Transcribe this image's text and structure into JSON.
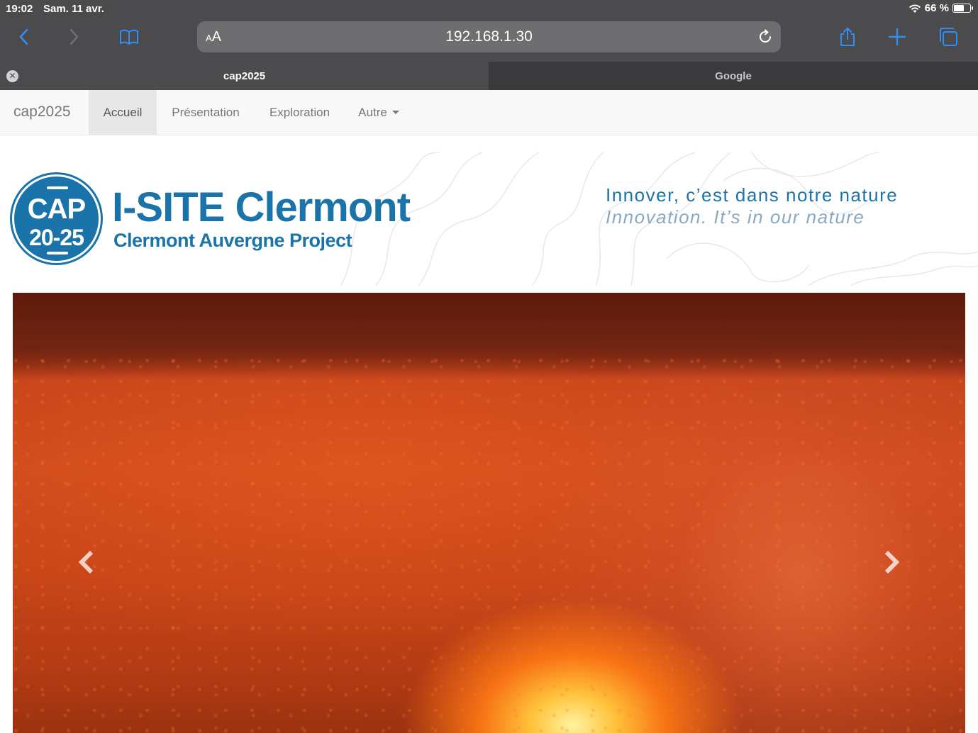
{
  "status_bar": {
    "time": "19:02",
    "date": "Sam. 11 avr.",
    "battery": "66 %",
    "battery_level": 0.66
  },
  "browser": {
    "reader_label_small": "A",
    "reader_label_large": "A",
    "address": "192.168.1.30",
    "tabs": [
      {
        "label": "cap2025",
        "active": true
      },
      {
        "label": "Google",
        "active": false
      }
    ],
    "icons": {
      "back": "chevron-left-icon",
      "forward": "chevron-right-icon",
      "bookmarks": "book-icon",
      "reload": "reload-icon",
      "share": "share-icon",
      "new_tab": "plus-icon",
      "tabs_overview": "tabs-icon"
    },
    "accent_color": "#2f8ef5"
  },
  "site": {
    "brand": "cap2025",
    "nav": [
      {
        "label": "Accueil",
        "active": true
      },
      {
        "label": "Présentation",
        "active": false
      },
      {
        "label": "Exploration",
        "active": false
      },
      {
        "label": "Autre",
        "active": false,
        "dropdown": true
      }
    ],
    "banner": {
      "logo_top": "CAP",
      "logo_bottom": "20-25",
      "title": "I-SITE Clermont",
      "subtitle": "Clermont Auvergne Project",
      "tagline_fr": "Innover, c’est dans notre nature",
      "tagline_en": "Innovation. It’s in our nature",
      "brand_color": "#1b74a9"
    },
    "carousel": {
      "prev_icon": "chevron-left-icon",
      "next_icon": "chevron-right-icon"
    }
  }
}
